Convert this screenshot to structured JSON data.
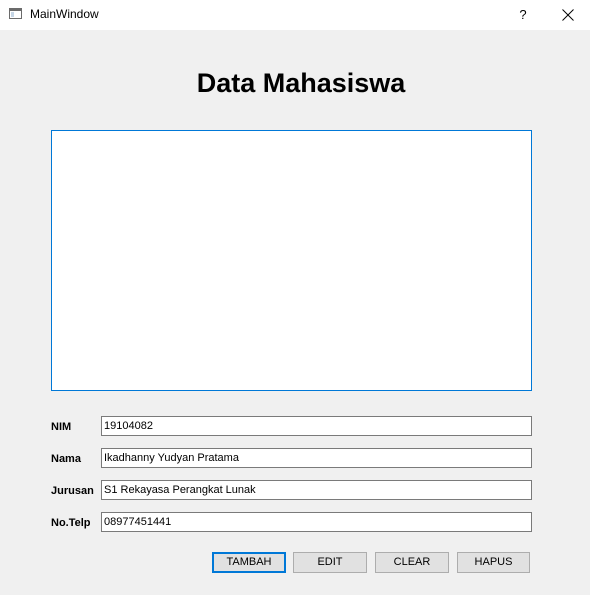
{
  "window": {
    "title": "MainWindow",
    "help_label": "?",
    "icon": "app-window-icon"
  },
  "heading": "Data Mahasiswa",
  "form": {
    "nim_label": "NIM",
    "nim_value": "19104082",
    "nama_label": "Nama",
    "nama_value": "Ikadhanny Yudyan Pratama",
    "jurusan_label": "Jurusan",
    "jurusan_value": "S1 Rekayasa Perangkat Lunak",
    "telp_label": "No.Telp",
    "telp_value": "08977451441"
  },
  "buttons": {
    "tambah": "TAMBAH",
    "edit": "EDIT",
    "clear": "CLEAR",
    "hapus": "HAPUS"
  },
  "colors": {
    "background": "#f0f0f0",
    "accent": "#0078d7"
  }
}
